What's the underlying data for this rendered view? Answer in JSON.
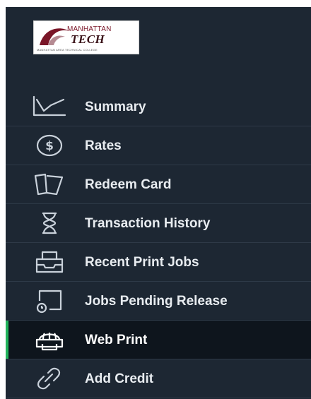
{
  "logo": {
    "line1": "MANHATTAN",
    "line2": "TECH",
    "tagline": "MANHATTAN AREA TECHNICAL COLLEGE"
  },
  "colors": {
    "sidebar_bg": "#1d2733",
    "active_bg": "#0e151d",
    "active_indicator": "#21b35b",
    "label": "#e8ecf0"
  },
  "menu": [
    {
      "label": "Summary",
      "icon": "line-chart-icon",
      "active": false
    },
    {
      "label": "Rates",
      "icon": "dollar-circle-icon",
      "active": false
    },
    {
      "label": "Redeem Card",
      "icon": "cards-icon",
      "active": false
    },
    {
      "label": "Transaction History",
      "icon": "hourglass-icon",
      "active": false
    },
    {
      "label": "Recent Print Jobs",
      "icon": "printer-tray-icon",
      "active": false
    },
    {
      "label": "Jobs Pending Release",
      "icon": "pending-release-icon",
      "active": false
    },
    {
      "label": "Web Print",
      "icon": "web-print-icon",
      "active": true
    },
    {
      "label": "Add Credit",
      "icon": "link-icon",
      "active": false
    }
  ]
}
